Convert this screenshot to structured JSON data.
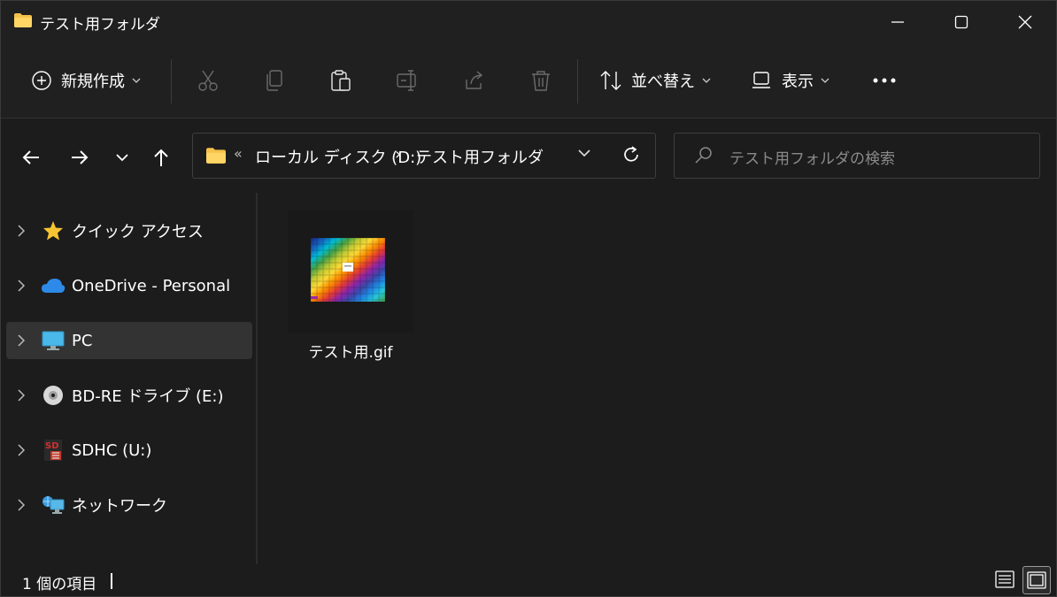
{
  "window": {
    "title": "テスト用フォルダ"
  },
  "toolbar": {
    "new_label": "新規作成",
    "sort_label": "並べ替え",
    "view_label": "表示"
  },
  "address": {
    "prefix": "«",
    "drive": "ローカル ディスク (D:)",
    "separator": "›",
    "folder": "テスト用フォルダ"
  },
  "search": {
    "placeholder": "テスト用フォルダの検索"
  },
  "sidebar": {
    "items": [
      {
        "label": "クイック アクセス",
        "icon": "star-icon"
      },
      {
        "label": "OneDrive - Personal",
        "icon": "cloud-icon"
      },
      {
        "label": "PC",
        "icon": "monitor-icon",
        "selected": true
      },
      {
        "label": "BD-RE ドライブ (E:)",
        "icon": "disc-icon"
      },
      {
        "label": "SDHC (U:)",
        "icon": "sd-card-icon"
      },
      {
        "label": "ネットワーク",
        "icon": "network-icon"
      }
    ]
  },
  "files": [
    {
      "name": "テスト用.gif"
    }
  ],
  "status": {
    "count_text": "1 個の項目"
  },
  "colors": {
    "background": "#1c1c1c",
    "chrome": "#202020",
    "folder": "#f6c24a",
    "accent": "#4aa3e0"
  }
}
